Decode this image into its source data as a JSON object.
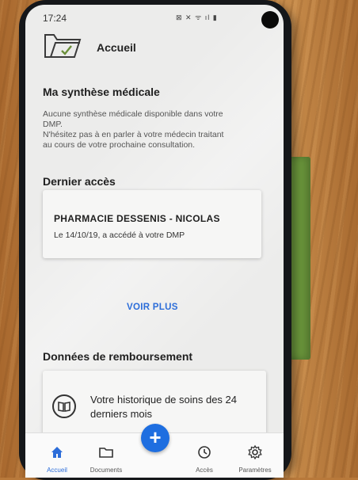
{
  "status_bar": {
    "time": "17:24",
    "icons": "⊠ ✕ ᯤ ıl ▮"
  },
  "app_bar": {
    "title": "Accueil",
    "logo_icon": "folder-logo-icon"
  },
  "synthese": {
    "heading": "Ma synthèse médicale",
    "lines": [
      "Aucune synthèse médicale disponible dans votre",
      "DMP.",
      "N'hésitez pas à en parler à votre médecin traitant",
      "au cours de votre prochaine consultation."
    ]
  },
  "dernier_acces": {
    "heading": "Dernier accès",
    "card_title": "PHARMACIE DESSENIS - NICOLAS",
    "card_subtitle": "Le 14/10/19, a accédé à votre DMP"
  },
  "voir_plus": "VOIR PLUS",
  "remboursement": {
    "heading": "Données de remboursement",
    "card_line1": "Votre historique de soins des 24",
    "card_line2": "derniers mois",
    "card_icon": "book-icon"
  },
  "bottom_nav": {
    "items": [
      {
        "label": "Accueil",
        "icon": "home-icon",
        "active": true
      },
      {
        "label": "Documents",
        "icon": "folder-icon",
        "active": false
      },
      {
        "label": "Accès",
        "icon": "history-icon",
        "active": false
      },
      {
        "label": "Paramètres",
        "icon": "gear-icon",
        "active": false
      }
    ],
    "fab_label": "+",
    "fab_icon": "plus-icon"
  },
  "colors": {
    "accent": "#2c6dd9",
    "fab": "#1e6ee0",
    "screen": "#ececeb",
    "phone": "#15171a",
    "wood": "#b8793b",
    "green_tab": "#6d9a3d"
  }
}
